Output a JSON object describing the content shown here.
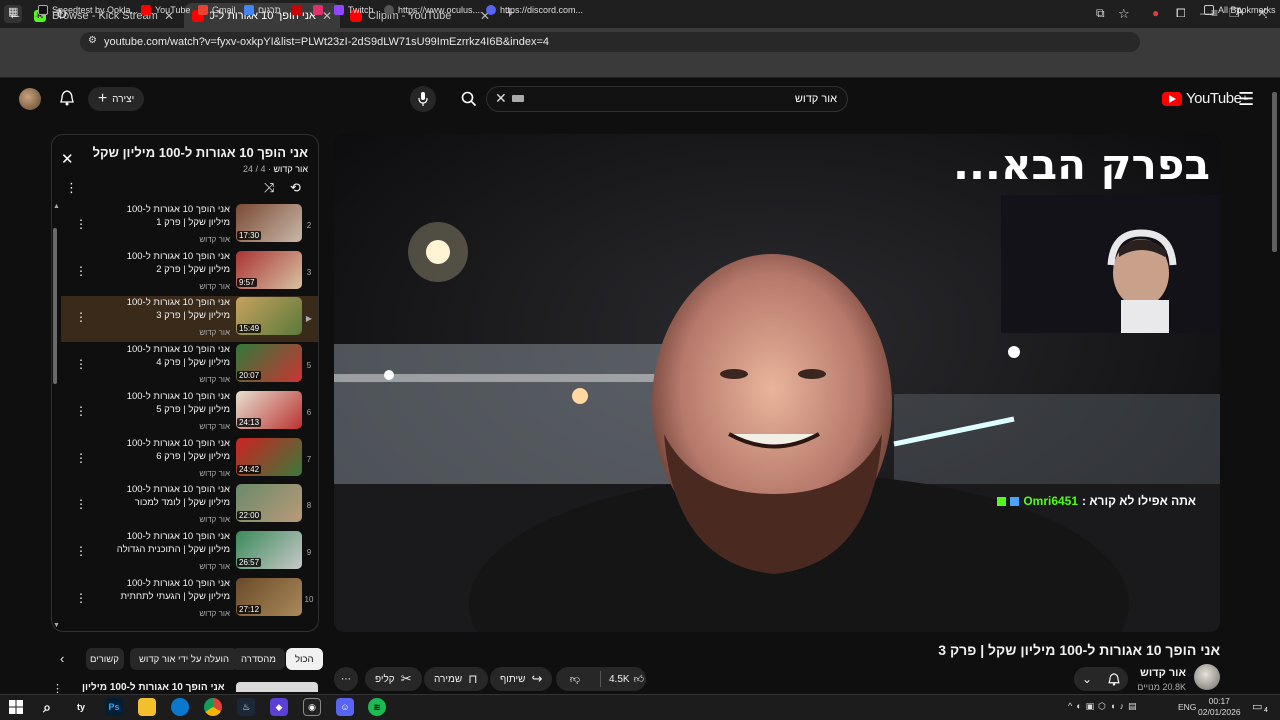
{
  "browser": {
    "tabs": [
      {
        "title": "Browse - Kick Streaming",
        "favicon_color": "#53fc18",
        "active": false
      },
      {
        "title": "אני הופך 10 אגורות ל-100 מיליון",
        "favicon_color": "#ff0000",
        "active": true
      },
      {
        "title": "Clipim - YouTube",
        "favicon_color": "#ff0000",
        "active": false
      }
    ],
    "url": "youtube.com/watch?v=fyxv-oxkpYI&list=PLWt23zI-2dS9dLW71sU99ImEzrrkz4I6B&index=4",
    "bookmarks": [
      {
        "label": "Speedtest by Ookla...",
        "color": "#1c1c1c"
      },
      {
        "label": "YouTube",
        "color": "#ff0000"
      },
      {
        "label": "Gmail",
        "color": "#ea4335"
      },
      {
        "label": "תרגום",
        "color": "#4285f4"
      },
      {
        "label": "",
        "color": "#c00"
      },
      {
        "label": "",
        "color": "#e1306c"
      },
      {
        "label": "Twitch",
        "color": "#9146ff"
      },
      {
        "label": "https://www.oculus....",
        "color": "#333"
      },
      {
        "label": "https://discord.com...",
        "color": "#5865f2"
      }
    ],
    "all_bookmarks": "All Bookmarks"
  },
  "header": {
    "logo_text": "YouTube",
    "logo_country": "IL",
    "search_value": "אור קדוש",
    "create_label": "יצירה"
  },
  "player": {
    "overlay_text": "בפרק הבא...",
    "chat_user": "Omri6451",
    "chat_message": "אתה אפילו לא קורא :"
  },
  "video": {
    "title": "אני הופך 10 אגורות ל-100 מיליון שקל | פרק 3",
    "channel": "אור קדוש",
    "subscribers": "20.8K מנויים",
    "likes": "4.5K",
    "share_label": "שיתוף",
    "save_label": "שמירה",
    "clip_label": "קליפ"
  },
  "playlist": {
    "title": "אני הופך 10 אגורות ל-100 מיליון שקל",
    "owner": "אור קדוש",
    "position": "4 / 24",
    "items": [
      {
        "num": "2",
        "title": "אני הופך 10 אגורות ל-100 מיליון שקל | פרק 1",
        "channel": "אור קדוש",
        "duration": "17:30",
        "c1": "#7a4a35",
        "c2": "#c9b8a8",
        "current": false
      },
      {
        "num": "3",
        "title": "אני הופך 10 אגורות ל-100 מיליון שקל | פרק 2",
        "channel": "אור קדוש",
        "duration": "9:57",
        "c1": "#a33",
        "c2": "#d7c2a3",
        "current": false
      },
      {
        "num": "▶",
        "title": "אני הופך 10 אגורות ל-100 מיליון שקל | פרק 3",
        "channel": "אור קדוש",
        "duration": "15:49",
        "c1": "#c7a15e",
        "c2": "#5a7a3a",
        "current": true
      },
      {
        "num": "5",
        "title": "אני הופך 10 אגורות ל-100 מיליון שקל | פרק 4",
        "channel": "אור קדוש",
        "duration": "20:07",
        "c1": "#2f7a3a",
        "c2": "#c33",
        "current": false
      },
      {
        "num": "6",
        "title": "אני הופך 10 אגורות ל-100 מיליון שקל | פרק 5",
        "channel": "אור קדוש",
        "duration": "24:13",
        "c1": "#e6e0d0",
        "c2": "#b33",
        "current": false
      },
      {
        "num": "7",
        "title": "אני הופך 10 אגורות ל-100 מיליון שקל | פרק 6",
        "channel": "אור קדוש",
        "duration": "24:42",
        "c1": "#c22",
        "c2": "#3a7a3a",
        "current": false
      },
      {
        "num": "8",
        "title": "אני הופך 10 אגורות ל-100 מיליון שקל | לומד למכור",
        "channel": "אור קדוש",
        "duration": "22:00",
        "c1": "#6a8a6a",
        "c2": "#b89a7a",
        "current": false
      },
      {
        "num": "9",
        "title": "אני הופך 10 אגורות ל-100 מיליון שקל | התוכנית הגדולה",
        "channel": "אור קדוש",
        "duration": "26:57",
        "c1": "#3a8a5a",
        "c2": "#c8c8c8",
        "current": false
      },
      {
        "num": "10",
        "title": "אני הופך 10 אגורות ל-100 מיליון שקל | הגעתי לתחתית",
        "channel": "אור קדוש",
        "duration": "27:12",
        "c1": "#6a4a2a",
        "c2": "#a88a5a",
        "current": false
      }
    ]
  },
  "chips": [
    {
      "label": "הכול",
      "selected": true
    },
    {
      "label": "מהסדרה",
      "selected": false
    },
    {
      "label": "הועלה על ידי אור קדוש",
      "selected": false
    },
    {
      "label": "קשורים",
      "selected": false
    }
  ],
  "next_item_title": "אני הופך 10 אגורות ל-100 מיליון",
  "taskbar": {
    "time": "00:17",
    "date": "02/01/2026",
    "lang": "ENG",
    "notifications": "4"
  }
}
